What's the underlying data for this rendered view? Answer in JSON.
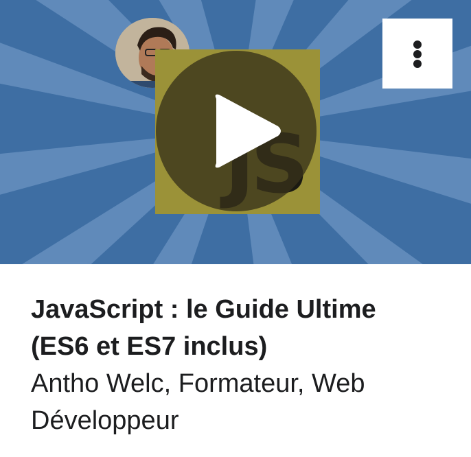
{
  "course": {
    "title_line1": "JavaScript : le Guide Ultime",
    "title_line2": "(ES6 et ES7 inclus)",
    "author_line1": "Antho Welc, Formateur, Web",
    "author_line2": "Développeur"
  },
  "thumbnail": {
    "logo_text": "JS",
    "play_icon": "play-icon",
    "menu_icon": "vertical-dots-icon"
  },
  "colors": {
    "background_blue": "#3e6ea3",
    "ray_light": "#6790bf",
    "js_yellow": "#9b9238",
    "text": "#1c1d1f"
  }
}
